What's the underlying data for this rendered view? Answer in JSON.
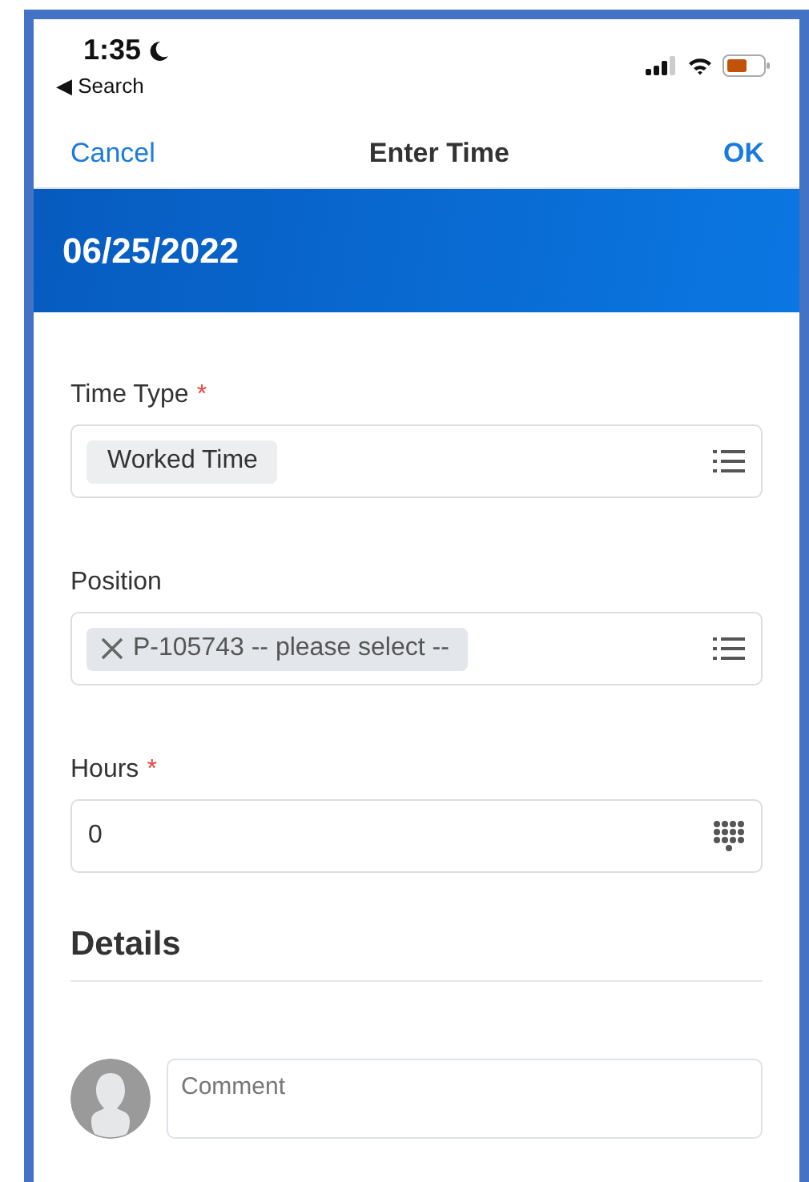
{
  "status_bar": {
    "time": "1:35",
    "back_label": "◀ Search"
  },
  "nav_bar": {
    "cancel": "Cancel",
    "title": "Enter Time",
    "ok": "OK"
  },
  "date_header": "06/25/2022",
  "fields": [
    {
      "kind": "select",
      "label": "Time Type",
      "required_mark": "*",
      "chip": "Worked Time",
      "removable": false
    },
    {
      "kind": "select",
      "label": "Position",
      "chip": "P-105743 -- please select --",
      "removable": true
    },
    {
      "kind": "number",
      "label": "Hours",
      "required_mark": "*",
      "value": "0"
    }
  ],
  "details": {
    "heading": "Details",
    "comment_placeholder": "Comment"
  }
}
